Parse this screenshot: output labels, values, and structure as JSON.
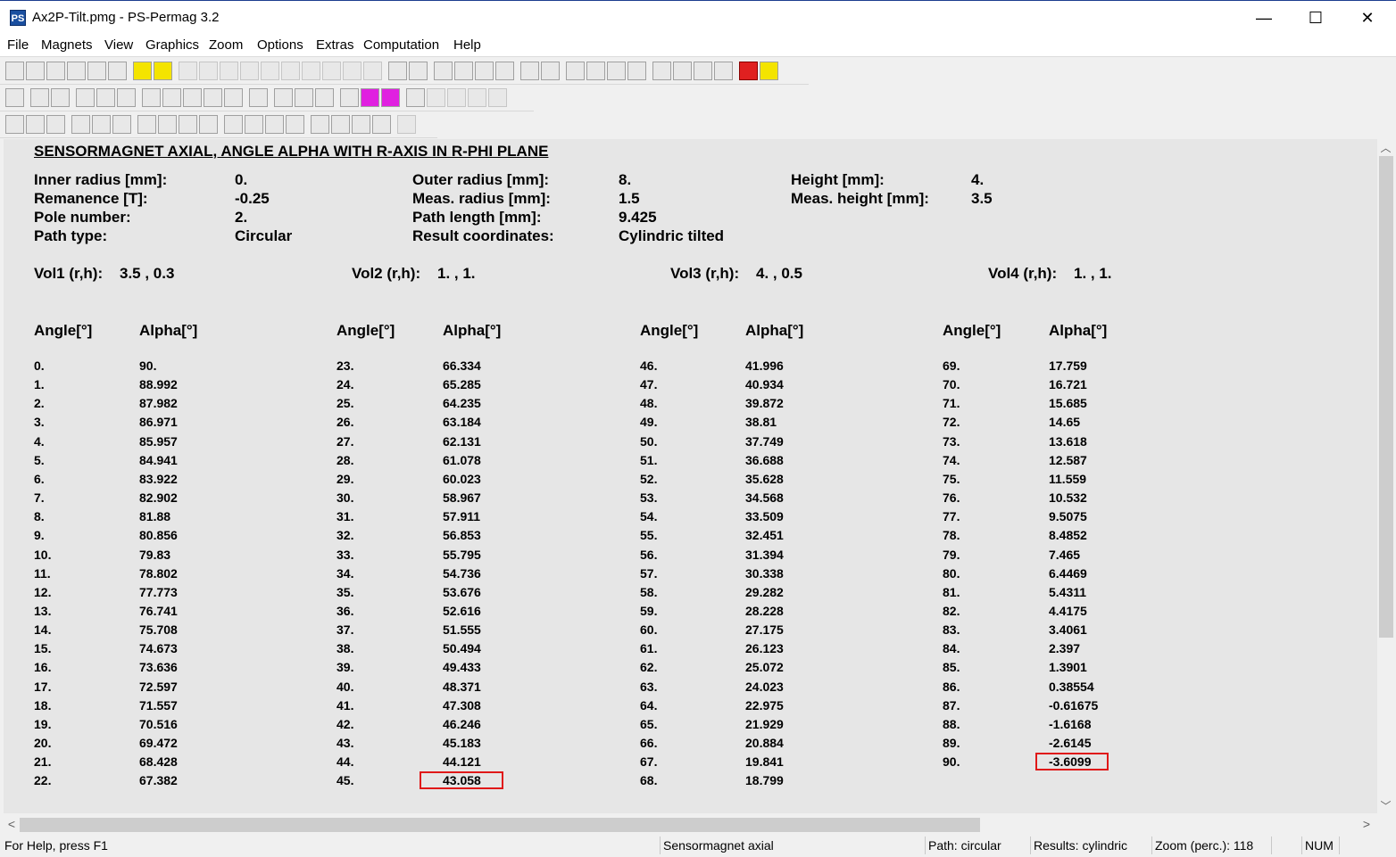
{
  "window": {
    "title": "Ax2P-Tilt.pmg - PS-Permag 3.2",
    "app_icon": "PS",
    "minimize_glyph": "—",
    "maximize_glyph": "☐",
    "close_glyph": "✕"
  },
  "menu": [
    "File",
    "Magnets",
    "View",
    "Graphics",
    "Zoom",
    "Options",
    "Extras",
    "Computation",
    "Help"
  ],
  "toolbars": {
    "row1": [
      "new-icon",
      "open-icon",
      "save-icon",
      "txt-icon",
      "txt2-icon",
      "print-icon",
      "|",
      "tp-icon",
      "ed-icon",
      "|",
      "3d-d-icon",
      "3d-m-icon",
      "3d-ms-icon",
      "3d-r-icon",
      "3d-rs-icon",
      "3d-l-icon",
      "3d-a-icon",
      "3d-as-icon",
      "3d-al-icon",
      "3d-c-icon",
      "|",
      "cs-icon",
      "h-icon",
      "|",
      "sd-icon",
      "sa-icon",
      "sl-icon",
      "ck-icon",
      "|",
      "m-icon",
      "r-icon",
      "|",
      "sort1-icon",
      "sort2-icon",
      "sort3-icon",
      "sort4-icon",
      "|",
      "calc1-icon",
      "calc2-icon",
      "calc3-icon",
      "calc4-icon",
      "|",
      "stop-icon",
      "go-icon"
    ],
    "row2": [
      "layers-icon",
      "|",
      "bar-red-icon",
      "line-icon",
      "|",
      "chart-icon",
      "colors-icon",
      "a-icon",
      "|",
      "grid-icon",
      "curve-icon",
      "dots-icon",
      "t-icon",
      "red-icon",
      "|",
      "table-icon",
      "|",
      "io-icon",
      "s0-icon",
      "df-icon",
      "|",
      "plusminus-icon",
      "plus-icon",
      "minus-icon",
      "|",
      "diag-icon",
      "arrow-icon",
      "cols-icon",
      "up-icon",
      "hist-icon"
    ],
    "row3": [
      "ai-icon",
      "bi-icon",
      "gi-icon",
      "|",
      "aa-icon",
      "ab-icon",
      "ag-icon",
      "|",
      "c1-icon",
      "c2-icon",
      "c3-icon",
      "c4-icon",
      "|",
      "bar1-icon",
      "bar2-icon",
      "bar3-icon",
      "bar4-icon",
      "|",
      "box1-icon",
      "box2-icon",
      "box3-icon",
      "box4-icon",
      "|",
      "img-icon"
    ]
  },
  "document": {
    "heading": "SENSORMAGNET AXIAL, ANGLE ALPHA WITH R-AXIS IN R-PHI PLANE",
    "params": [
      {
        "label": "Inner radius [mm]:",
        "value": "0."
      },
      {
        "label": "Remanence [T]:",
        "value": "-0.25"
      },
      {
        "label": "Pole number:",
        "value": "2."
      },
      {
        "label": "Path type:",
        "value": "Circular"
      },
      {
        "label": "Outer radius [mm]:",
        "value": "8."
      },
      {
        "label": "Meas. radius [mm]:",
        "value": "1.5"
      },
      {
        "label": "Path length [mm]:",
        "value": "9.425"
      },
      {
        "label": "Result coordinates:",
        "value": "Cylindric tilted"
      },
      {
        "label": "Height [mm]:",
        "value": "4."
      },
      {
        "label": "Meas. height [mm]:",
        "value": "3.5"
      }
    ],
    "volumes": [
      {
        "label": "Vol1 (r,h):",
        "value": "3.5 , 0.3"
      },
      {
        "label": "Vol2 (r,h):",
        "value": "1. , 1."
      },
      {
        "label": "Vol3 (r,h):",
        "value": "4. , 0.5"
      },
      {
        "label": "Vol4 (r,h):",
        "value": "1. , 1."
      }
    ],
    "table_headers": {
      "angle": "Angle[°]",
      "alpha": "Alpha[°]"
    },
    "columns": [
      [
        [
          "0.",
          "90."
        ],
        [
          "1.",
          "88.992"
        ],
        [
          "2.",
          "87.982"
        ],
        [
          "3.",
          "86.971"
        ],
        [
          "4.",
          "85.957"
        ],
        [
          "5.",
          "84.941"
        ],
        [
          "6.",
          "83.922"
        ],
        [
          "7.",
          "82.902"
        ],
        [
          "8.",
          "81.88"
        ],
        [
          "9.",
          "80.856"
        ],
        [
          "10.",
          "79.83"
        ],
        [
          "11.",
          "78.802"
        ],
        [
          "12.",
          "77.773"
        ],
        [
          "13.",
          "76.741"
        ],
        [
          "14.",
          "75.708"
        ],
        [
          "15.",
          "74.673"
        ],
        [
          "16.",
          "73.636"
        ],
        [
          "17.",
          "72.597"
        ],
        [
          "18.",
          "71.557"
        ],
        [
          "19.",
          "70.516"
        ],
        [
          "20.",
          "69.472"
        ],
        [
          "21.",
          "68.428"
        ],
        [
          "22.",
          "67.382"
        ]
      ],
      [
        [
          "23.",
          "66.334"
        ],
        [
          "24.",
          "65.285"
        ],
        [
          "25.",
          "64.235"
        ],
        [
          "26.",
          "63.184"
        ],
        [
          "27.",
          "62.131"
        ],
        [
          "28.",
          "61.078"
        ],
        [
          "29.",
          "60.023"
        ],
        [
          "30.",
          "58.967"
        ],
        [
          "31.",
          "57.911"
        ],
        [
          "32.",
          "56.853"
        ],
        [
          "33.",
          "55.795"
        ],
        [
          "34.",
          "54.736"
        ],
        [
          "35.",
          "53.676"
        ],
        [
          "36.",
          "52.616"
        ],
        [
          "37.",
          "51.555"
        ],
        [
          "38.",
          "50.494"
        ],
        [
          "39.",
          "49.433"
        ],
        [
          "40.",
          "48.371"
        ],
        [
          "41.",
          "47.308"
        ],
        [
          "42.",
          "46.246"
        ],
        [
          "43.",
          "45.183"
        ],
        [
          "44.",
          "44.121"
        ],
        [
          "45.",
          "43.058"
        ]
      ],
      [
        [
          "46.",
          "41.996"
        ],
        [
          "47.",
          "40.934"
        ],
        [
          "48.",
          "39.872"
        ],
        [
          "49.",
          "38.81"
        ],
        [
          "50.",
          "37.749"
        ],
        [
          "51.",
          "36.688"
        ],
        [
          "52.",
          "35.628"
        ],
        [
          "53.",
          "34.568"
        ],
        [
          "54.",
          "33.509"
        ],
        [
          "55.",
          "32.451"
        ],
        [
          "56.",
          "31.394"
        ],
        [
          "57.",
          "30.338"
        ],
        [
          "58.",
          "29.282"
        ],
        [
          "59.",
          "28.228"
        ],
        [
          "60.",
          "27.175"
        ],
        [
          "61.",
          "26.123"
        ],
        [
          "62.",
          "25.072"
        ],
        [
          "63.",
          "24.023"
        ],
        [
          "64.",
          "22.975"
        ],
        [
          "65.",
          "21.929"
        ],
        [
          "66.",
          "20.884"
        ],
        [
          "67.",
          "19.841"
        ],
        [
          "68.",
          "18.799"
        ]
      ],
      [
        [
          "69.",
          "17.759"
        ],
        [
          "70.",
          "16.721"
        ],
        [
          "71.",
          "15.685"
        ],
        [
          "72.",
          "14.65"
        ],
        [
          "73.",
          "13.618"
        ],
        [
          "74.",
          "12.587"
        ],
        [
          "75.",
          "11.559"
        ],
        [
          "76.",
          "10.532"
        ],
        [
          "77.",
          "9.5075"
        ],
        [
          "78.",
          "8.4852"
        ],
        [
          "79.",
          "7.465"
        ],
        [
          "80.",
          "6.4469"
        ],
        [
          "81.",
          "5.4311"
        ],
        [
          "82.",
          "4.4175"
        ],
        [
          "83.",
          "3.4061"
        ],
        [
          "84.",
          "2.397"
        ],
        [
          "85.",
          "1.3901"
        ],
        [
          "86.",
          "0.38554"
        ],
        [
          "87.",
          "-0.61675"
        ],
        [
          "88.",
          "-1.6168"
        ],
        [
          "89.",
          "-2.6145"
        ],
        [
          "90.",
          "-3.6099"
        ]
      ]
    ],
    "highlighted_values": [
      "43.058",
      "-3.6099"
    ],
    "highlight_color": "#e01818"
  },
  "scrollbars": {
    "up": "︿",
    "down": "﹀",
    "left": "<",
    "right": ">"
  },
  "status": {
    "help": "For Help, press F1",
    "magnet": "Sensormagnet axial",
    "path": "Path: circular",
    "results": "Results: cylindric",
    "zoom": "Zoom (perc.): 118",
    "blank": "",
    "num": "NUM"
  }
}
